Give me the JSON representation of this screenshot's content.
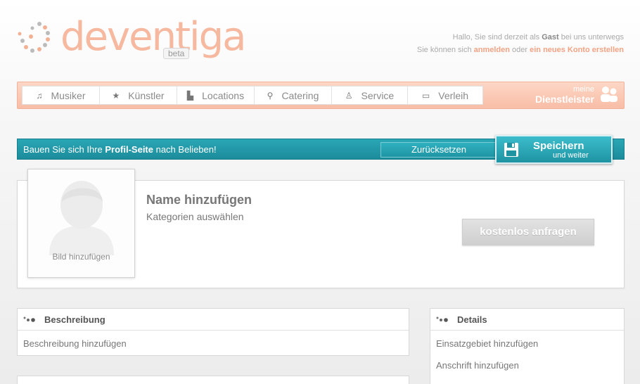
{
  "brand": {
    "name": "deventiga",
    "badge": "beta",
    "color": "#f6b89f"
  },
  "welcome": {
    "line1_pre": "Hallo, Sie sind derzeit als ",
    "line1_bold": "Gast",
    "line1_post": " bei uns unterwegs",
    "line2_pre": "Sie können sich ",
    "login_link": "anmelden",
    "line2_mid": " oder ",
    "register_link": "ein neues Konto erstellen"
  },
  "nav": {
    "items": [
      {
        "label": "Musiker",
        "icon": "music-note-icon",
        "glyph": "♫"
      },
      {
        "label": "Künstler",
        "icon": "star-icon",
        "glyph": "★"
      },
      {
        "label": "Locations",
        "icon": "building-icon",
        "glyph": "▙"
      },
      {
        "label": "Catering",
        "icon": "glass-icon",
        "glyph": "⚲"
      },
      {
        "label": "Service",
        "icon": "person-icon",
        "glyph": "♙"
      },
      {
        "label": "Verleih",
        "icon": "monitor-icon",
        "glyph": "▭"
      }
    ],
    "meine_small": "meine",
    "meine_big": "Dienstleister"
  },
  "teal_bar": {
    "text_pre": "Bauen Sie sich Ihre ",
    "text_bold": "Profil-Seite",
    "text_post": " nach Belieben!",
    "reset_label": "Zurücksetzen",
    "save_label": "Speichern",
    "save_sub": "und weiter",
    "color": "#1f95a4"
  },
  "profile": {
    "photo_label": "Bild hinzufügen",
    "name_placeholder": "Name hinzufügen",
    "categories_placeholder": "Kategorien auswählen",
    "request_label": "kostenlos anfragen"
  },
  "description_panel": {
    "title": "Beschreibung",
    "link": "Beschreibung hinzufügen"
  },
  "details_panel": {
    "title": "Details",
    "links": [
      "Einsatzgebiet hinzufügen",
      "Anschrift hinzufügen"
    ]
  }
}
